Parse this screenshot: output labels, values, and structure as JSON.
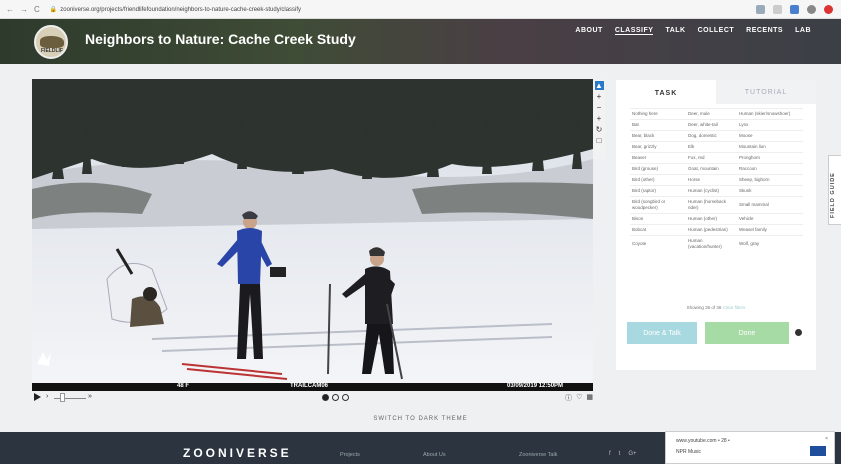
{
  "browser": {
    "url": "zooniverse.org/projects/friendlifefoundation/neighbors-to-nature-cache-creek-study/classify",
    "nav": [
      "←",
      "→",
      "C"
    ]
  },
  "header": {
    "title": "Neighbors to Nature: Cache Creek Study",
    "logo_text": "FIELDLIF",
    "nav": [
      "ABOUT",
      "CLASSIFY",
      "TALK",
      "COLLECT",
      "RECENTS",
      "LAB"
    ]
  },
  "viewer": {
    "temp": "48 F",
    "camera": "TRAILCAM06",
    "timestamp": "03/09/2019 12:50PM",
    "speed": "›",
    "speed_fast": "»",
    "tools": [
      "▲",
      "+",
      "−",
      "+",
      "↻",
      "□"
    ]
  },
  "task_panel": {
    "tabs": [
      "TASK",
      "TUTORIAL"
    ],
    "choices": [
      [
        "Nothing here",
        "Deer, mule",
        "Human (skier/snowshoer)"
      ],
      [
        "Bat",
        "Deer, white-tail",
        "Lynx"
      ],
      [
        "Bear, black",
        "Dog, domestic",
        "Moose"
      ],
      [
        "Bear, grizzly",
        "Elk",
        "Mountain lion"
      ],
      [
        "Beaver",
        "Fox, red",
        "Pronghorn"
      ],
      [
        "Bird (grouse)",
        "Goat, mountain",
        "Raccoon"
      ],
      [
        "Bird (other)",
        "Horse",
        "Sheep, bighorn"
      ],
      [
        "Bird (raptor)",
        "Human (cyclist)",
        "Skunk"
      ],
      [
        "Bird (songbird or woodpecker)",
        "Human (horseback rider)",
        "Small mammal"
      ],
      [
        "Bison",
        "Human (other)",
        "Vehicle"
      ],
      [
        "Bobcat",
        "Human (pedestrian)",
        "Weasel family"
      ],
      [
        "Coyote",
        "Human (vacation/hunter)",
        "Wolf, gray"
      ]
    ],
    "showing": "Showing 36 of 36",
    "clear": "Clear filters",
    "done_talk": "Done & Talk",
    "done": "Done"
  },
  "switch_theme": "SWITCH TO DARK THEME",
  "field_guide": "FIELD GUIDE",
  "footer": {
    "brand": "ZOONIVERSE",
    "links": [
      "Projects",
      "About Us",
      "Zooniverse Talk"
    ],
    "social": [
      "f",
      "t",
      "G+"
    ]
  },
  "notification": {
    "site": "www.youtube.com • 28 •",
    "name": "NPR Music"
  },
  "colors": {
    "done": "#a6dba6",
    "done_talk": "#a8d9e0",
    "footer": "#2c3440"
  }
}
